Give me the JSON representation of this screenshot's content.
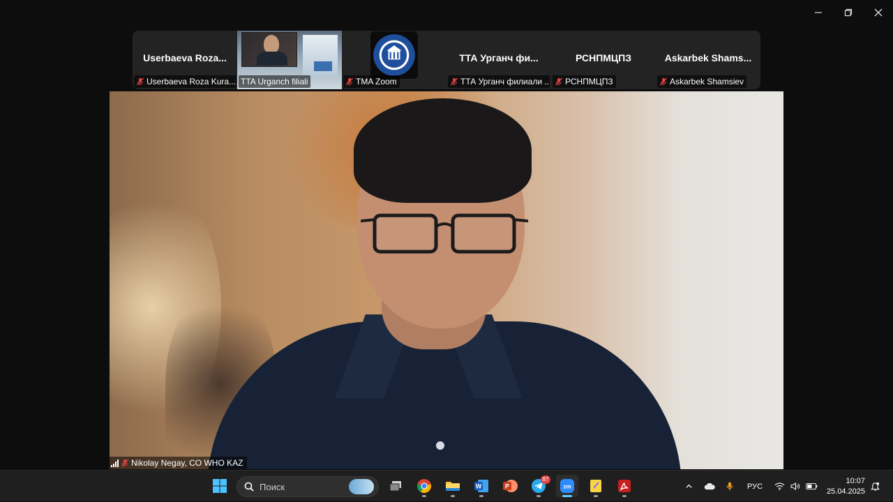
{
  "window": {
    "controls": [
      "minimize-icon",
      "restore-icon",
      "close-icon"
    ]
  },
  "participants": [
    {
      "tile_name": "Userbaeva  Roza...",
      "label": "Userbaeva Roza Kura...",
      "muted": true,
      "type": "name"
    },
    {
      "tile_name": "",
      "label": "TTA Urganch filiali",
      "muted": false,
      "type": "video"
    },
    {
      "tile_name": "",
      "label": "TMA Zoom",
      "muted": true,
      "type": "logo"
    },
    {
      "tile_name": "ТТА  Урганч  фи...",
      "label": "ТТА Урганч филиали ...",
      "muted": true,
      "type": "name"
    },
    {
      "tile_name": "РСНПМЦПЗ",
      "label": "РСНПМЦПЗ",
      "muted": true,
      "type": "name"
    },
    {
      "tile_name": "Askarbek  Shams...",
      "label": "Askarbek Shamsiev",
      "muted": true,
      "type": "name"
    }
  ],
  "main_speaker": {
    "label": "Nikolay Negay, CO WHO KAZ",
    "muted": true
  },
  "taskbar": {
    "search_placeholder": "Поиск",
    "telegram_badge": "87",
    "language": "РУС",
    "time": "10:07",
    "date": "25.04.2025"
  },
  "colors": {
    "zoom_blue": "#2d8cff",
    "muted_red": "#e04343",
    "taskbar": "#1f1f1f"
  }
}
